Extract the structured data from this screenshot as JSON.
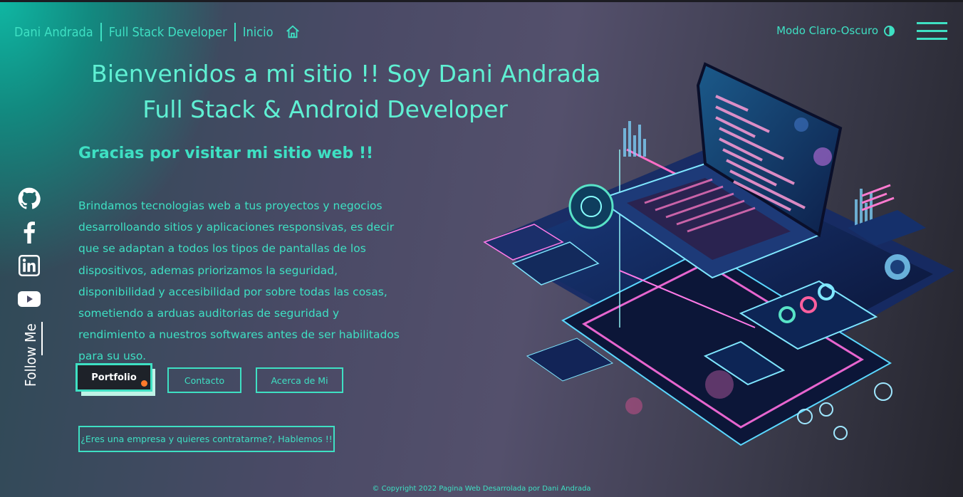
{
  "header": {
    "brand_name": "Dani Andrada",
    "brand_role": "Full Stack Developer",
    "nav_home": "Inicio",
    "mode_toggle": "Modo Claro-Oscuro"
  },
  "hero": {
    "title_line1": "Bienvenidos a mi sitio !! Soy Dani Andrada",
    "title_line2": "Full Stack & Android Developer",
    "subtitle": "Gracias por visitar mi sitio web !!",
    "paragraph": "Brindamos tecnologias web a tus proyectos y negocios desarrolloando sitios y aplicaciones responsivas, es decir que se adaptan a todos los tipos de pantallas de los dispositivos, ademas priorizamos la seguridad, disponibilidad y accesibilidad por sobre todas las cosas, sometiendo a arduas auditorias de seguridad y rendimiento a nuestros softwares antes de ser habilitados para su uso."
  },
  "buttons": {
    "portfolio": "Portfolio",
    "contact": "Contacto",
    "about": "Acerca de Mi",
    "hire": "¿Eres una empresa y quieres contratarme?, Hablemos !!"
  },
  "social": {
    "follow_label": "Follow Me",
    "icons": [
      "github-icon",
      "facebook-icon",
      "linkedin-icon",
      "youtube-icon"
    ]
  },
  "footer": {
    "copyright": "© Copyright 2022 Pagina Web Desarrolada por Dani Andrada"
  },
  "colors": {
    "accent": "#3ee0c3",
    "cta_dot": "#ff7a2b"
  }
}
